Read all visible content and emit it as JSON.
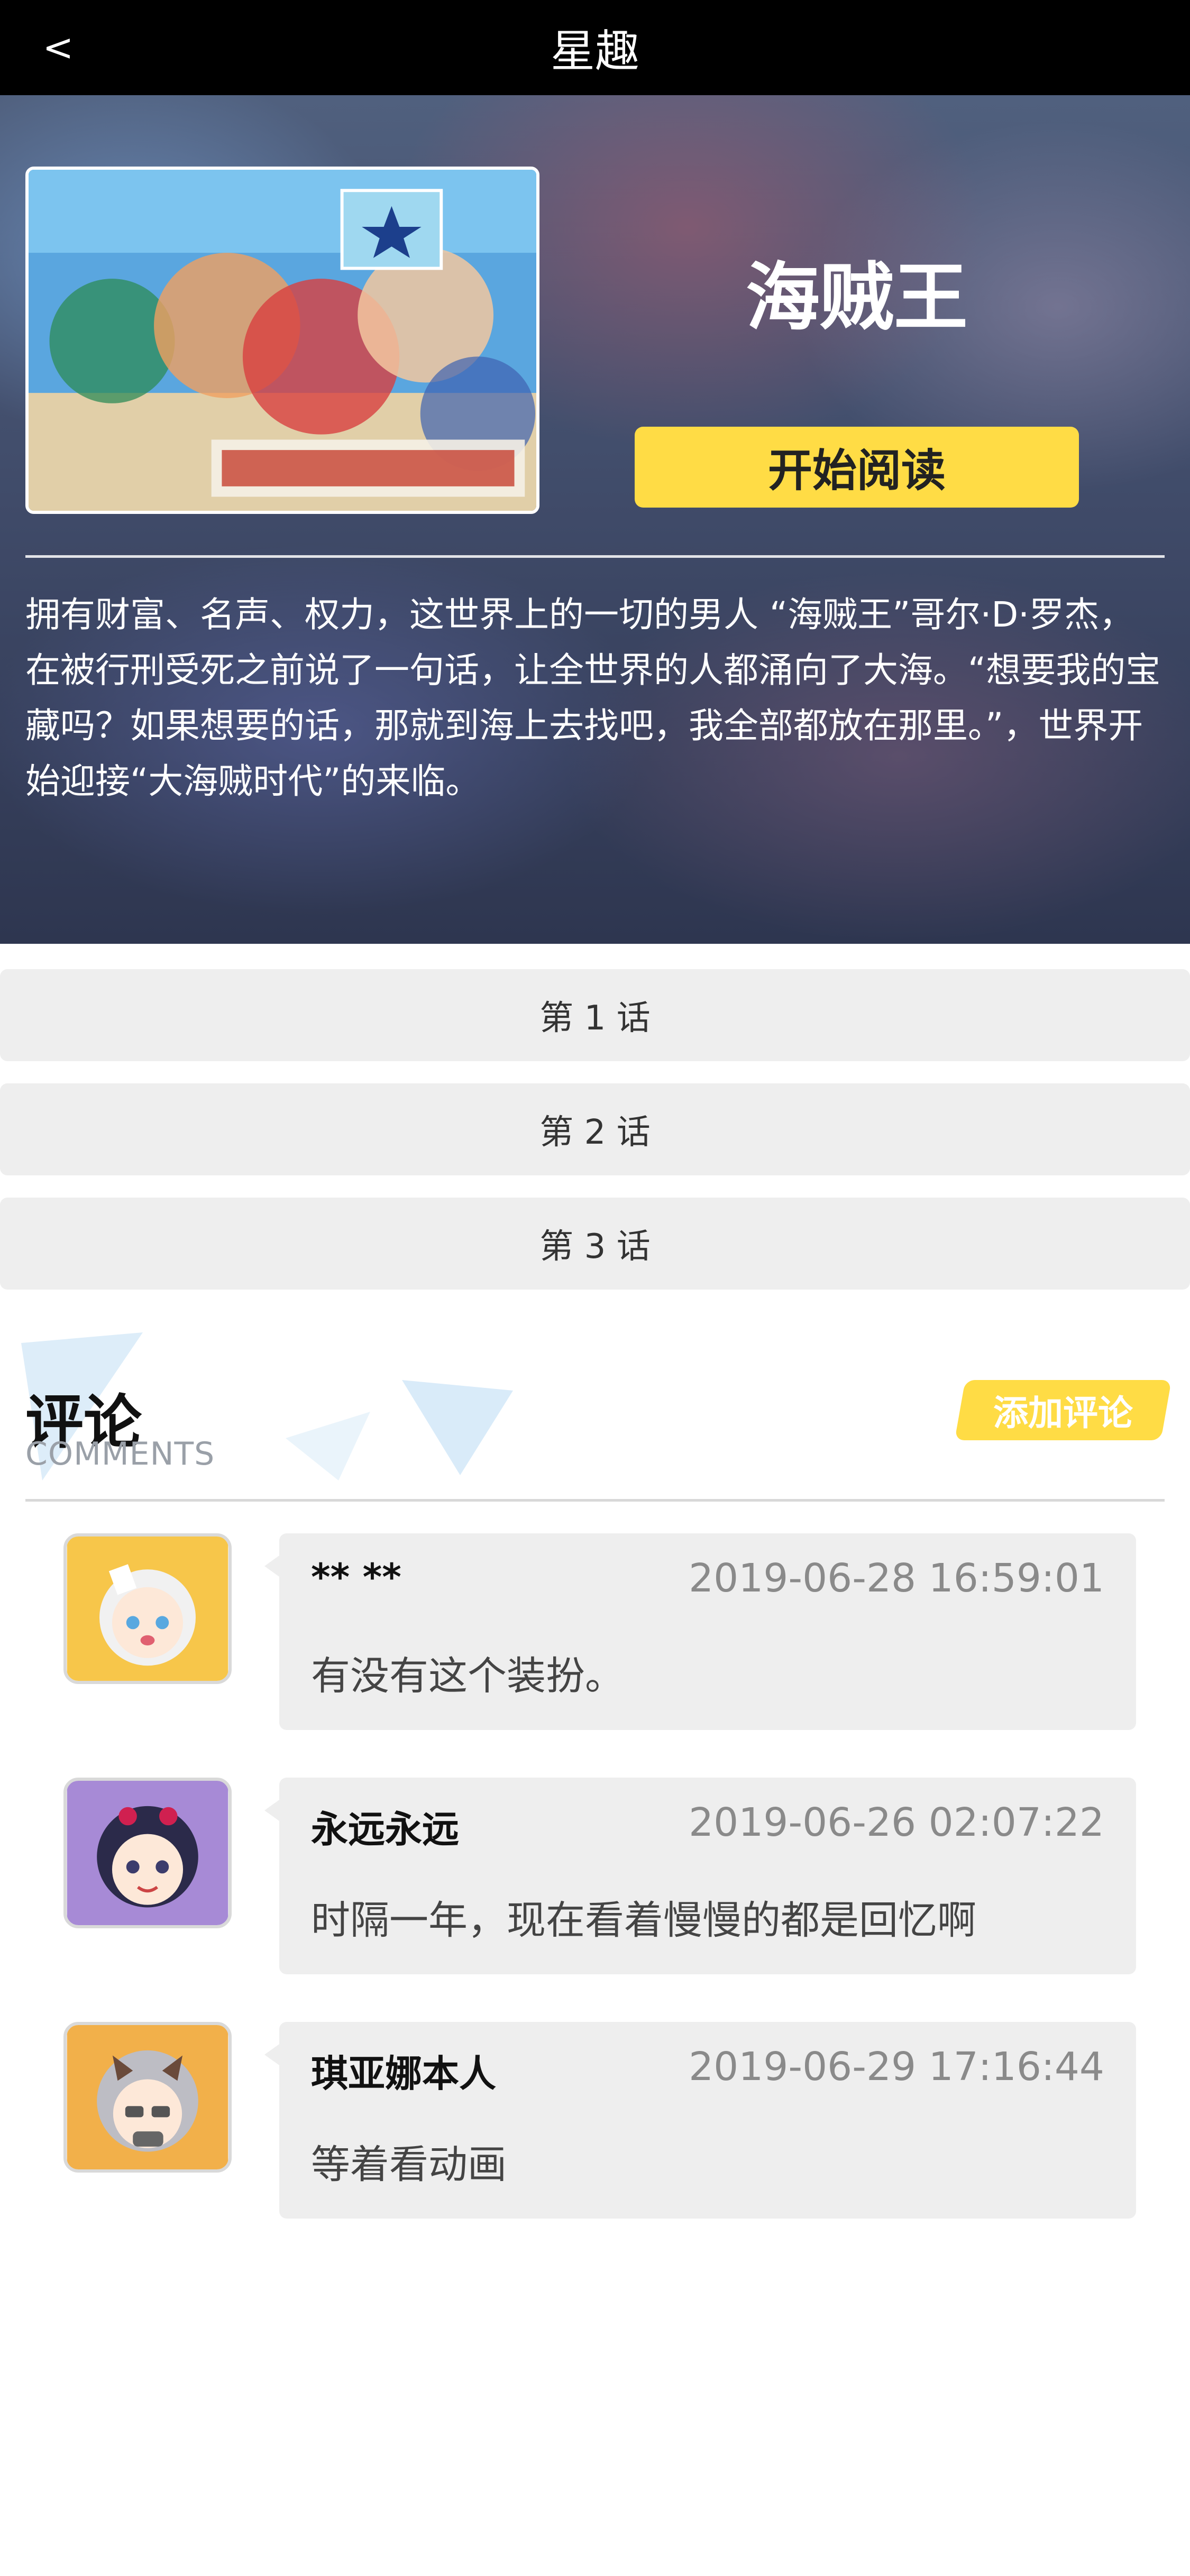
{
  "header": {
    "back_label": "<",
    "title": "星趣"
  },
  "book": {
    "title": "海贼王",
    "read_button": "开始阅读",
    "cover_icon": "one-piece-cover-image",
    "description": "拥有财富、名声、权力，这世界上的一切的男人 “海贼王”哥尔·D·罗杰，在被行刑受死之前说了一句话，让全世界的人都涌向了大海。“想要我的宝藏吗？如果想要的话，那就到海上去找吧，我全部都放在那里。”，世界开始迎接“大海贼时代”的来临。"
  },
  "chapters": [
    {
      "label": "第 1 话"
    },
    {
      "label": "第 2 话"
    },
    {
      "label": "第 3 话"
    }
  ],
  "comments_section": {
    "title": "评论",
    "subtitle": "COMMENTS",
    "add_button": "添加评论"
  },
  "comments": [
    {
      "user": "** **",
      "time": "2019-06-28 16:59:01",
      "text": "有没有这个装扮。",
      "avatar": "anime-girl-white-hair-avatar"
    },
    {
      "user": "永远永远",
      "time": "2019-06-26 02:07:22",
      "text": "时隔一年，现在看着慢慢的都是回忆啊",
      "avatar": "anime-girl-purple-avatar"
    },
    {
      "user": "琪亚娜本人",
      "time": "2019-06-29 17:16:44",
      "text": "等着看动画",
      "avatar": "anime-girl-gray-hair-avatar"
    }
  ],
  "colors": {
    "accent": "#ffdc45",
    "topbar": "#000000",
    "card_bg": "#eeeeee"
  }
}
